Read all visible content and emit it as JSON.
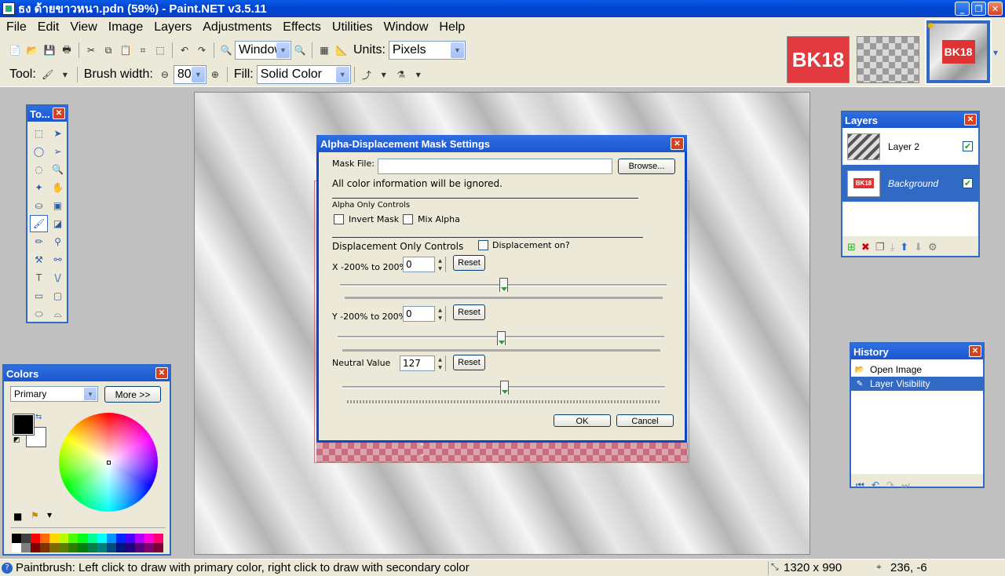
{
  "window": {
    "title": "ธง ด้ายขาวหนา.pdn (59%) - Paint.NET v3.5.11"
  },
  "menu": [
    "File",
    "Edit",
    "View",
    "Image",
    "Layers",
    "Adjustments",
    "Effects",
    "Utilities",
    "Window",
    "Help"
  ],
  "toolbar": {
    "zoom_value": "Window",
    "units_label": "Units:",
    "units_value": "Pixels",
    "tool_label": "Tool:",
    "brush_width_label": "Brush width:",
    "brush_width_value": "80",
    "fill_label": "Fill:",
    "fill_value": "Solid Color"
  },
  "image_tabs": [
    {
      "label": "BK18"
    },
    {
      "label": ""
    },
    {
      "label": "BK18"
    }
  ],
  "tools_window": {
    "title": "To..."
  },
  "colors_window": {
    "title": "Colors",
    "mode": "Primary",
    "more_button": "More >>",
    "primary_color": "#000000",
    "secondary_color": "#ffffff",
    "palette": [
      "#000000",
      "#404040",
      "#ff0000",
      "#ff6a00",
      "#ffd800",
      "#b6ff00",
      "#4cff00",
      "#00ff21",
      "#00ff90",
      "#00ffff",
      "#0094ff",
      "#0026ff",
      "#4800ff",
      "#b200ff",
      "#ff00dc",
      "#ff006e",
      "#ffffff",
      "#808080",
      "#7f0000",
      "#7f3300",
      "#7f6a00",
      "#5b7f00",
      "#267f00",
      "#007f0e",
      "#007f46",
      "#007f7f",
      "#004a7f",
      "#00137f",
      "#21007f",
      "#57007f",
      "#7f006e",
      "#7f0037"
    ]
  },
  "layers_window": {
    "title": "Layers",
    "layers": [
      {
        "name": "Layer 2",
        "visible": true,
        "selected": false
      },
      {
        "name": "Background",
        "visible": true,
        "selected": true,
        "thumb_label": "BK18"
      }
    ]
  },
  "history_window": {
    "title": "History",
    "items": [
      {
        "label": "Open Image",
        "selected": false
      },
      {
        "label": "Layer Visibility",
        "selected": true
      }
    ]
  },
  "dialog": {
    "title": "Alpha-Displacement Mask Settings",
    "mask_file_label": "Mask File:",
    "mask_file_value": "",
    "browse_button": "Browse...",
    "info_text": "All color information will be ignored.",
    "alpha_section": "Alpha Only Controls",
    "invert_mask_label": "Invert Mask",
    "mix_alpha_label": "Mix Alpha",
    "displacement_section": "Displacement Only Controls",
    "displacement_on_label": "Displacement on?",
    "x_label": "X -200% to 200%",
    "x_value": "0",
    "y_label": "Y -200% to 200%",
    "y_value": "0",
    "neutral_label": "Neutral Value",
    "neutral_value": "127",
    "reset_label": "Reset",
    "ok_button": "OK",
    "cancel_button": "Cancel",
    "x_slider": 0.5,
    "y_slider": 0.5,
    "neutral_slider": 0.5
  },
  "status": {
    "message": "Paintbrush: Left click to draw with primary color, right click to draw with secondary color",
    "image_size": "1320 x 990",
    "cursor_pos": "236, -6"
  }
}
